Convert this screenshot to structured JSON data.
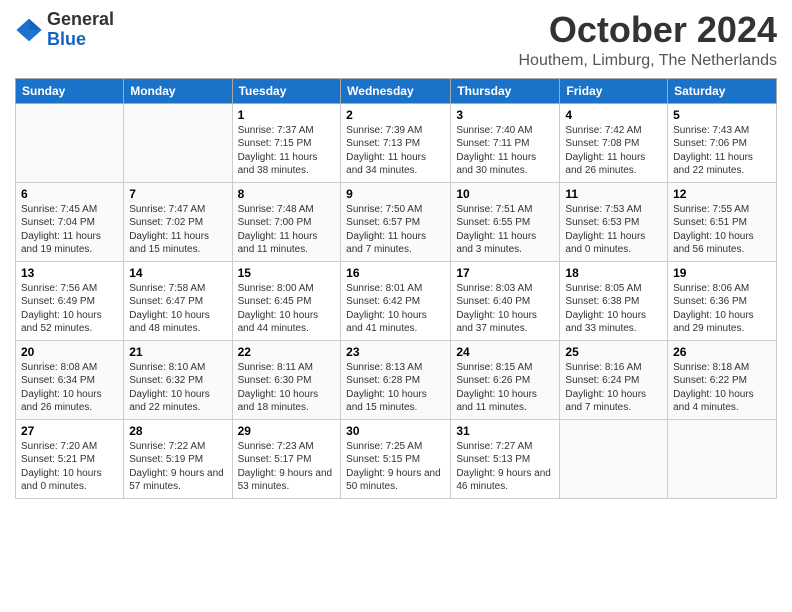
{
  "logo": {
    "general": "General",
    "blue": "Blue"
  },
  "header": {
    "month": "October 2024",
    "location": "Houthem, Limburg, The Netherlands"
  },
  "days_of_week": [
    "Sunday",
    "Monday",
    "Tuesday",
    "Wednesday",
    "Thursday",
    "Friday",
    "Saturday"
  ],
  "weeks": [
    [
      {
        "day": "",
        "info": ""
      },
      {
        "day": "",
        "info": ""
      },
      {
        "day": "1",
        "info": "Sunrise: 7:37 AM\nSunset: 7:15 PM\nDaylight: 11 hours and 38 minutes."
      },
      {
        "day": "2",
        "info": "Sunrise: 7:39 AM\nSunset: 7:13 PM\nDaylight: 11 hours and 34 minutes."
      },
      {
        "day": "3",
        "info": "Sunrise: 7:40 AM\nSunset: 7:11 PM\nDaylight: 11 hours and 30 minutes."
      },
      {
        "day": "4",
        "info": "Sunrise: 7:42 AM\nSunset: 7:08 PM\nDaylight: 11 hours and 26 minutes."
      },
      {
        "day": "5",
        "info": "Sunrise: 7:43 AM\nSunset: 7:06 PM\nDaylight: 11 hours and 22 minutes."
      }
    ],
    [
      {
        "day": "6",
        "info": "Sunrise: 7:45 AM\nSunset: 7:04 PM\nDaylight: 11 hours and 19 minutes."
      },
      {
        "day": "7",
        "info": "Sunrise: 7:47 AM\nSunset: 7:02 PM\nDaylight: 11 hours and 15 minutes."
      },
      {
        "day": "8",
        "info": "Sunrise: 7:48 AM\nSunset: 7:00 PM\nDaylight: 11 hours and 11 minutes."
      },
      {
        "day": "9",
        "info": "Sunrise: 7:50 AM\nSunset: 6:57 PM\nDaylight: 11 hours and 7 minutes."
      },
      {
        "day": "10",
        "info": "Sunrise: 7:51 AM\nSunset: 6:55 PM\nDaylight: 11 hours and 3 minutes."
      },
      {
        "day": "11",
        "info": "Sunrise: 7:53 AM\nSunset: 6:53 PM\nDaylight: 11 hours and 0 minutes."
      },
      {
        "day": "12",
        "info": "Sunrise: 7:55 AM\nSunset: 6:51 PM\nDaylight: 10 hours and 56 minutes."
      }
    ],
    [
      {
        "day": "13",
        "info": "Sunrise: 7:56 AM\nSunset: 6:49 PM\nDaylight: 10 hours and 52 minutes."
      },
      {
        "day": "14",
        "info": "Sunrise: 7:58 AM\nSunset: 6:47 PM\nDaylight: 10 hours and 48 minutes."
      },
      {
        "day": "15",
        "info": "Sunrise: 8:00 AM\nSunset: 6:45 PM\nDaylight: 10 hours and 44 minutes."
      },
      {
        "day": "16",
        "info": "Sunrise: 8:01 AM\nSunset: 6:42 PM\nDaylight: 10 hours and 41 minutes."
      },
      {
        "day": "17",
        "info": "Sunrise: 8:03 AM\nSunset: 6:40 PM\nDaylight: 10 hours and 37 minutes."
      },
      {
        "day": "18",
        "info": "Sunrise: 8:05 AM\nSunset: 6:38 PM\nDaylight: 10 hours and 33 minutes."
      },
      {
        "day": "19",
        "info": "Sunrise: 8:06 AM\nSunset: 6:36 PM\nDaylight: 10 hours and 29 minutes."
      }
    ],
    [
      {
        "day": "20",
        "info": "Sunrise: 8:08 AM\nSunset: 6:34 PM\nDaylight: 10 hours and 26 minutes."
      },
      {
        "day": "21",
        "info": "Sunrise: 8:10 AM\nSunset: 6:32 PM\nDaylight: 10 hours and 22 minutes."
      },
      {
        "day": "22",
        "info": "Sunrise: 8:11 AM\nSunset: 6:30 PM\nDaylight: 10 hours and 18 minutes."
      },
      {
        "day": "23",
        "info": "Sunrise: 8:13 AM\nSunset: 6:28 PM\nDaylight: 10 hours and 15 minutes."
      },
      {
        "day": "24",
        "info": "Sunrise: 8:15 AM\nSunset: 6:26 PM\nDaylight: 10 hours and 11 minutes."
      },
      {
        "day": "25",
        "info": "Sunrise: 8:16 AM\nSunset: 6:24 PM\nDaylight: 10 hours and 7 minutes."
      },
      {
        "day": "26",
        "info": "Sunrise: 8:18 AM\nSunset: 6:22 PM\nDaylight: 10 hours and 4 minutes."
      }
    ],
    [
      {
        "day": "27",
        "info": "Sunrise: 7:20 AM\nSunset: 5:21 PM\nDaylight: 10 hours and 0 minutes."
      },
      {
        "day": "28",
        "info": "Sunrise: 7:22 AM\nSunset: 5:19 PM\nDaylight: 9 hours and 57 minutes."
      },
      {
        "day": "29",
        "info": "Sunrise: 7:23 AM\nSunset: 5:17 PM\nDaylight: 9 hours and 53 minutes."
      },
      {
        "day": "30",
        "info": "Sunrise: 7:25 AM\nSunset: 5:15 PM\nDaylight: 9 hours and 50 minutes."
      },
      {
        "day": "31",
        "info": "Sunrise: 7:27 AM\nSunset: 5:13 PM\nDaylight: 9 hours and 46 minutes."
      },
      {
        "day": "",
        "info": ""
      },
      {
        "day": "",
        "info": ""
      }
    ]
  ]
}
